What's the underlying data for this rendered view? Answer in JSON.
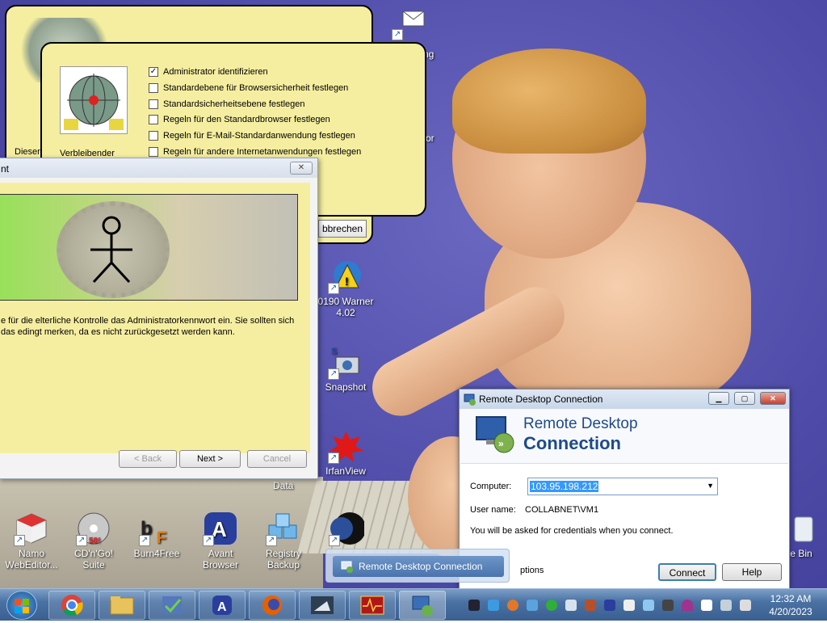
{
  "desktop": {
    "icons": [
      {
        "id": "mail",
        "label": "ng"
      },
      {
        "id": "warner",
        "label": "0190 Warner 4.02"
      },
      {
        "id": "snapshot",
        "label": "Snapshot"
      },
      {
        "id": "irfanview",
        "label": "IrfanView"
      },
      {
        "id": "data",
        "label": "Data"
      },
      {
        "id": "namo",
        "label": "Namo WebEditor..."
      },
      {
        "id": "cdngo",
        "label": "CD'n'Go! Suite"
      },
      {
        "id": "burn4free",
        "label": "Burn4Free"
      },
      {
        "id": "avant",
        "label": "Avant Browser"
      },
      {
        "id": "registry",
        "label": "Registry Backup"
      },
      {
        "id": "recycle",
        "label": "e Bin"
      }
    ],
    "side_text": "or"
  },
  "parental_dialog_back": {
    "text": "Dieser",
    "button_label": "bbrechen"
  },
  "parental_dialog": {
    "side_label": "Verbleibender",
    "options": [
      {
        "label": "Administrator identifizieren",
        "checked": true
      },
      {
        "label": "Standardebene für Browsersicherheit festlegen",
        "checked": false
      },
      {
        "label": "Standardsicherheitsebene festlegen",
        "checked": false
      },
      {
        "label": "Regeln für den Standardbrowser festlegen",
        "checked": false
      },
      {
        "label": "Regeln für E-Mail-Standardanwendung festlegen",
        "checked": false
      },
      {
        "label": "Regeln für andere Internetanwendungen festlegen",
        "checked": false
      }
    ]
  },
  "wizard": {
    "title": "nt",
    "close_glyph": "✕",
    "message": "e für die elterliche Kontrolle das Administratorkennwort ein. Sie sollten sich das edingt merken, da es nicht zurückgesetzt werden kann.",
    "back_label": "< Back",
    "next_label": "Next >",
    "cancel_label": "Cancel"
  },
  "rdc": {
    "window_title": "Remote Desktop Connection",
    "header_line1": "Remote Desktop",
    "header_line2": "Connection",
    "computer_label": "Computer:",
    "computer_value": "103.95.198.212",
    "username_label": "User name:",
    "username_value": "COLLABNET\\VM1",
    "info_text": "You will be asked for credentials when you connect.",
    "options_label": "ptions",
    "connect_label": "Connect",
    "help_label": "Help"
  },
  "taskbar": {
    "popup_label": "Remote Desktop Connection",
    "clock_time": "12:32 AM",
    "clock_date": "4/20/2023"
  },
  "colors": {
    "dialog_yellow": "#f5eea0",
    "taskbar_blue": "#4a72a3",
    "rdc_header_blue": "#1f4a8a"
  }
}
